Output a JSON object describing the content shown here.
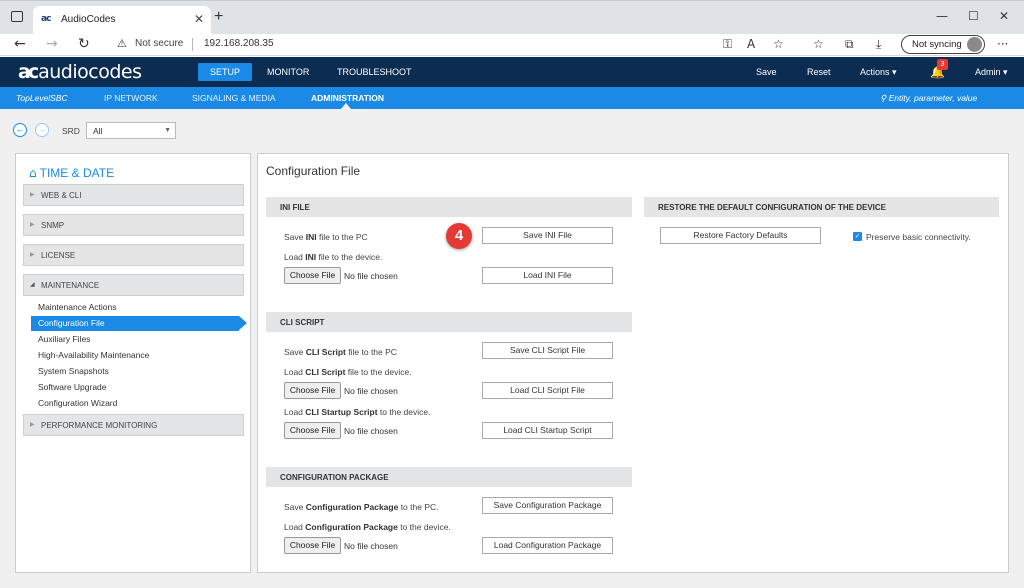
{
  "browser": {
    "tab_title": "AudioCodes",
    "favicon_text": "ac",
    "security_label": "Not secure",
    "url": "192.168.208.35",
    "sync_label": "Not syncing"
  },
  "header": {
    "logo_mark": "ac",
    "logo_text": "audiocodes",
    "nav": [
      "SETUP",
      "MONITOR",
      "TROUBLESHOOT"
    ],
    "save": "Save",
    "reset": "Reset",
    "actions": "Actions",
    "notifications_count": "3",
    "user": "Admin"
  },
  "subnav": {
    "device": "TopLevelSBC",
    "items": [
      "IP NETWORK",
      "SIGNALING & MEDIA",
      "ADMINISTRATION"
    ],
    "search_placeholder": "Entity, parameter, value"
  },
  "srd": {
    "label": "SRD",
    "value": "All"
  },
  "sidebar": {
    "title": "TIME & DATE",
    "groups": [
      "WEB & CLI",
      "SNMP",
      "LICENSE",
      "MAINTENANCE",
      "PERFORMANCE MONITORING"
    ],
    "maintenance_items": [
      "Maintenance Actions",
      "Configuration File",
      "Auxiliary Files",
      "High-Availability Maintenance",
      "System Snapshots",
      "Software Upgrade",
      "Configuration Wizard"
    ]
  },
  "panel": {
    "title": "Configuration File",
    "ini": {
      "heading": "INI FILE",
      "save_pre": "Save ",
      "save_bold": "INI",
      "save_post": " file to the PC",
      "load_pre": "Load ",
      "load_bold": "INI",
      "load_post": " file to the device.",
      "save_btn": "Save INI File",
      "load_btn": "Load INI File"
    },
    "cli": {
      "heading": "CLI SCRIPT",
      "save_pre": "Save ",
      "save_bold": "CLI Script",
      "save_post": " file to the PC",
      "load_pre": "Load ",
      "load_bold": "CLI Script",
      "load_post": " file to the device.",
      "startup_pre": "Load ",
      "startup_bold": "CLI Startup Script",
      "startup_post": " to the device.",
      "save_btn": "Save CLI Script File",
      "load_btn": "Load CLI Script File",
      "startup_btn": "Load CLI Startup Script"
    },
    "pkg": {
      "heading": "CONFIGURATION PACKAGE",
      "save_pre": "Save ",
      "save_bold": "Configuration Package",
      "save_post": " to the PC.",
      "load_pre": "Load ",
      "load_bold": "Configuration Package",
      "load_post": " to the device.",
      "save_btn": "Save Configuration Package",
      "load_btn": "Load Configuration Package"
    },
    "restore": {
      "heading": "RESTORE THE DEFAULT CONFIGURATION OF THE DEVICE",
      "btn": "Restore Factory Defaults",
      "checkbox_label": "Preserve basic connectivity."
    },
    "choose_file": "Choose File",
    "no_file": "No file chosen"
  },
  "annotation": {
    "step": "4"
  },
  "colors": {
    "header_bg": "#0c2c52",
    "accent": "#1a8ae6",
    "badge": "#e53935"
  }
}
